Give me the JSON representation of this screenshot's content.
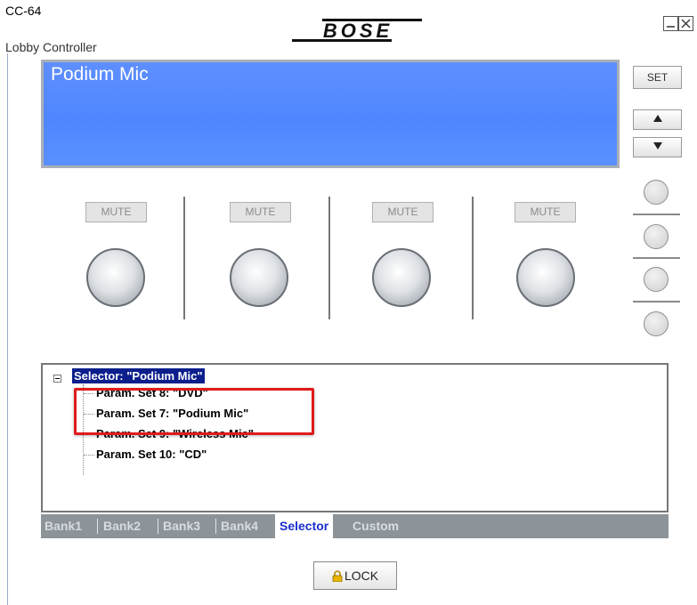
{
  "window": {
    "title": "CC-64",
    "subtitle": "Lobby Controller",
    "brand": "BOSE"
  },
  "display": {
    "text": "Podium Mic",
    "bg_color": "#4f86ff"
  },
  "side_controls": {
    "set_label": "SET",
    "up_icon": "triangle-up-icon",
    "down_icon": "triangle-down-icon"
  },
  "channels": [
    {
      "mute_label": "MUTE"
    },
    {
      "mute_label": "MUTE"
    },
    {
      "mute_label": "MUTE"
    },
    {
      "mute_label": "MUTE"
    }
  ],
  "tree": {
    "root_label": "Selector: \"Podium Mic\"",
    "items": [
      {
        "label": "Param. Set 8: \"DVD\""
      },
      {
        "label": "Param. Set 7: \"Podium Mic\""
      },
      {
        "label": "Param. Set 9: \"Wireless Mic\""
      },
      {
        "label": "Param. Set 10: \"CD\""
      }
    ]
  },
  "tabs": [
    {
      "label": "Bank1"
    },
    {
      "label": "Bank2"
    },
    {
      "label": "Bank3"
    },
    {
      "label": "Bank4"
    },
    {
      "label": "Selector",
      "active": true
    },
    {
      "label": "Custom"
    }
  ],
  "lock": {
    "label": "LOCK",
    "icon": "padlock-icon"
  },
  "colors": {
    "highlight": "#e01b1b",
    "selection": "#0b1e8c",
    "active_tab_text": "#1a2fd0"
  }
}
